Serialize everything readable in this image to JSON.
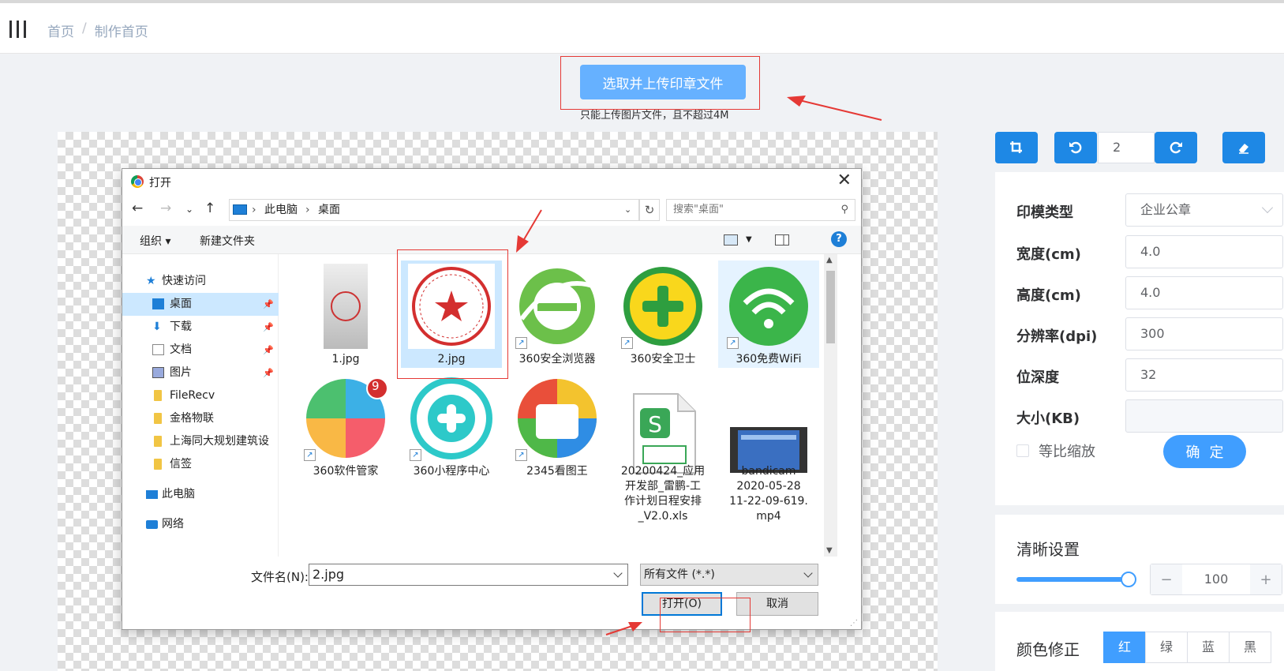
{
  "breadcrumb": {
    "home": "首页",
    "separator": "/",
    "current": "制作首页"
  },
  "upload": {
    "button_label": "选取并上传印章文件",
    "tip": "只能上传图片文件，且不超过4M"
  },
  "toolbar": {
    "rotate_value": "2"
  },
  "form": {
    "stamp_type_label": "印模类型",
    "stamp_type_value": "企业公章",
    "width_label": "宽度(cm)",
    "width_value": "4.0",
    "height_label": "高度(cm)",
    "height_value": "4.0",
    "dpi_label": "分辨率(dpi)",
    "dpi_value": "300",
    "depth_label": "位深度",
    "depth_value": "32",
    "size_label": "大小(KB)",
    "size_value": "",
    "ratio_label": "等比缩放",
    "confirm_label": "确定"
  },
  "clarity": {
    "title": "清晰设置",
    "value": "100",
    "slider_fraction": 1.0,
    "minus": "−",
    "plus": "+"
  },
  "color": {
    "title": "颜色修正",
    "options": [
      "红",
      "绿",
      "蓝",
      "黑"
    ],
    "selected": "红"
  },
  "dialog": {
    "title": "打开",
    "path": [
      "此电脑",
      "桌面"
    ],
    "search_placeholder": "搜索\"桌面\"",
    "organize": "组织 ▾",
    "new_folder": "新建文件夹",
    "nav": {
      "quick_access": "快速访问",
      "desktop": "桌面",
      "downloads": "下载",
      "documents": "文档",
      "pictures": "图片",
      "filerecv": "FileRecv",
      "jinge": "金格物联",
      "shanghai": "上海同大规划建筑设",
      "xinqian": "信签",
      "this_pc": "此电脑",
      "network": "网络"
    },
    "files": [
      {
        "name": "1.jpg"
      },
      {
        "name": "2.jpg"
      },
      {
        "name": "360安全浏览器"
      },
      {
        "name": "360安全卫士"
      },
      {
        "name": "360免费WiFi"
      },
      {
        "name": "360软件管家"
      },
      {
        "name": "360小程序中心"
      },
      {
        "name": "2345看图王"
      },
      {
        "name": "20200424_应用\n开发部_雷鹏-工\n作计划日程安排\n_V2.0.xls"
      },
      {
        "name": "bandicam\n2020-05-28\n11-22-09-619.\nmp4"
      }
    ],
    "badge_count": "9",
    "filename_label": "文件名(N):",
    "filename_value": "2.jpg",
    "filetype": "所有文件 (*.*)",
    "open_label": "打开(O)",
    "cancel_label": "取消",
    "close": "✕"
  },
  "colors": {
    "primary": "#409eff",
    "toolbar_blue": "#1e88e5",
    "annotation_red": "#e53935"
  }
}
